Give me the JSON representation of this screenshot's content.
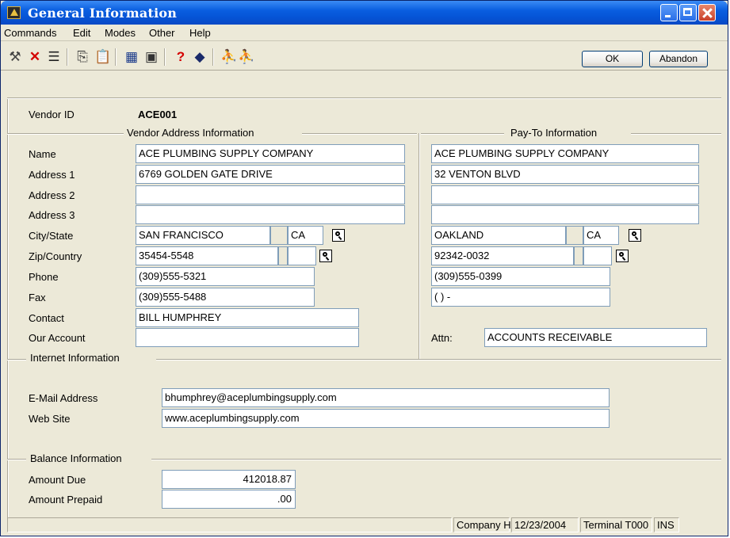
{
  "window": {
    "title": "General Information"
  },
  "menu": {
    "items": [
      "Commands",
      "Edit",
      "Modes",
      "Other",
      "Help"
    ]
  },
  "toolbar": {
    "ok_label": "OK",
    "abandon_label": "Abandon"
  },
  "vendor": {
    "id_label": "Vendor ID",
    "id_value": "ACE001"
  },
  "vendor_address": {
    "section_title": "Vendor Address Information",
    "labels": {
      "name": "Name",
      "address1": "Address 1",
      "address2": "Address 2",
      "address3": "Address 3",
      "city_state": "City/State",
      "zip_country": "Zip/Country",
      "phone": "Phone",
      "fax": "Fax",
      "contact": "Contact",
      "our_account": "Our Account"
    },
    "name": "ACE PLUMBING SUPPLY COMPANY",
    "address1": "6769 GOLDEN GATE DRIVE",
    "address2": "",
    "address3": "",
    "city": "SAN FRANCISCO",
    "state": "CA",
    "zip": "35454-5548",
    "country": "",
    "phone": "(309)555-5321",
    "fax": "(309)555-5488",
    "contact": "BILL HUMPHREY",
    "our_account": ""
  },
  "pay_to": {
    "section_title": "Pay-To Information",
    "name": "ACE PLUMBING SUPPLY COMPANY",
    "address1": "32 VENTON BLVD",
    "address2": "",
    "address3": "",
    "city": "OAKLAND",
    "state": "CA",
    "zip": "92342-0032",
    "country": "",
    "phone": "(309)555-0399",
    "fax": "(  )  -",
    "attn_label": "Attn:",
    "attn": "ACCOUNTS RECEIVABLE"
  },
  "internet": {
    "section_title": "Internet Information",
    "email_label": "E-Mail Address",
    "email": "bhumphrey@aceplumbingsupply.com",
    "web_label": "Web Site",
    "web": "www.aceplumbingsupply.com"
  },
  "balance": {
    "section_title": "Balance Information",
    "amount_due_label": "Amount Due",
    "amount_due": "412018.87",
    "amount_prepaid_label": "Amount Prepaid",
    "amount_prepaid": ".00"
  },
  "status_bar": {
    "company": "Company H",
    "date": "12/23/2004",
    "terminal": "Terminal T000",
    "mode": "INS"
  },
  "icons": [
    "tools-icon",
    "delete-icon",
    "list-icon",
    "copy-icon",
    "paste-icon",
    "calculator-icon",
    "calendar-icon",
    "help-icon",
    "manual-icon",
    "archer-icon",
    "archer-icon"
  ]
}
